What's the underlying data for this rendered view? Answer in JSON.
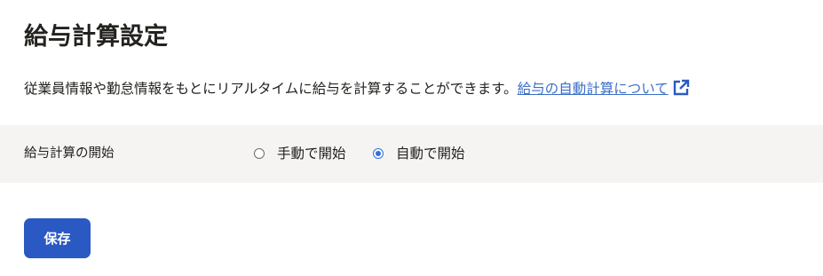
{
  "page": {
    "title": "給与計算設定",
    "description": "従業員情報や勤怠情報をもとにリアルタイムに給与を計算することができます。",
    "help_link_label": "給与の自動計算について"
  },
  "setting": {
    "label": "給与計算の開始",
    "options": [
      {
        "label": "手動で開始",
        "selected": false
      },
      {
        "label": "自動で開始",
        "selected": true
      }
    ]
  },
  "actions": {
    "save_label": "保存"
  },
  "icons": {
    "link": "external-link-icon"
  },
  "colors": {
    "primary": "#2b59c3",
    "link": "#3b6fc7",
    "radio_selected": "#2f6fe0",
    "row_background": "#f5f4f3",
    "text": "#23221e"
  }
}
